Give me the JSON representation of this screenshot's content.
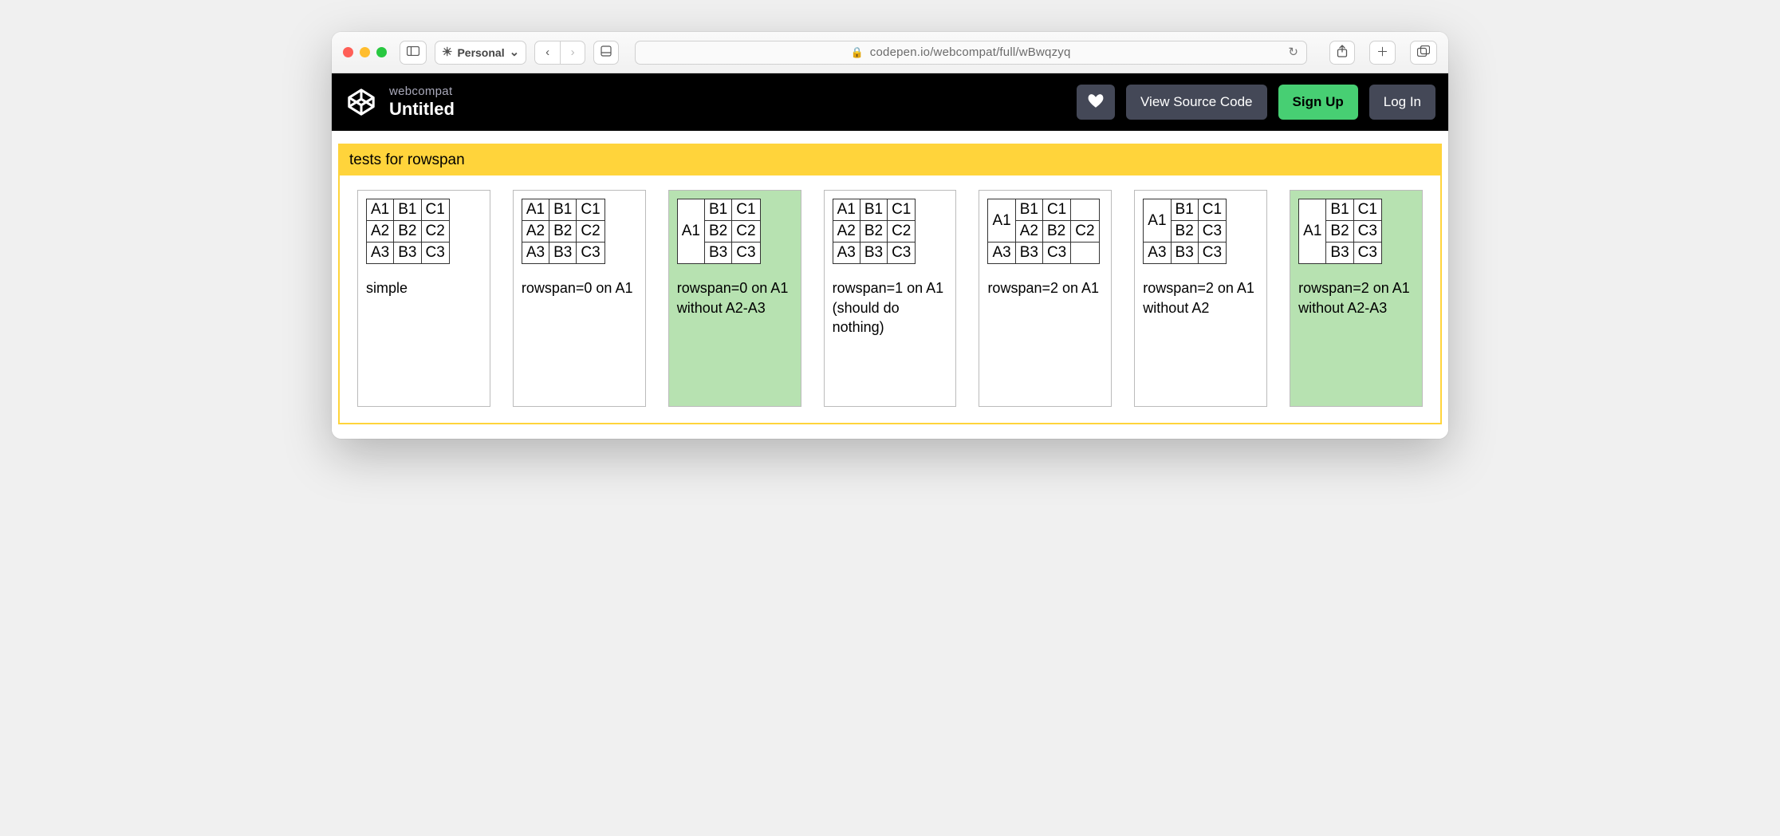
{
  "browser": {
    "profile_label": "Personal",
    "url_display": "codepen.io/webcompat/full/wBwqzyq"
  },
  "header": {
    "author": "webcompat",
    "title": "Untitled",
    "view_source_label": "View Source Code",
    "signup_label": "Sign Up",
    "login_label": "Log In"
  },
  "content": {
    "section_title": "tests for rowspan",
    "cards": [
      {
        "caption": "simple",
        "highlight": false,
        "table": {
          "rows": [
            [
              {
                "text": "A1"
              },
              {
                "text": "B1"
              },
              {
                "text": "C1"
              }
            ],
            [
              {
                "text": "A2"
              },
              {
                "text": "B2"
              },
              {
                "text": "C2"
              }
            ],
            [
              {
                "text": "A3"
              },
              {
                "text": "B3"
              },
              {
                "text": "C3"
              }
            ]
          ]
        }
      },
      {
        "caption": "rowspan=0 on A1",
        "highlight": false,
        "table": {
          "rows": [
            [
              {
                "text": "A1"
              },
              {
                "text": "B1"
              },
              {
                "text": "C1"
              }
            ],
            [
              {
                "text": "A2"
              },
              {
                "text": "B2"
              },
              {
                "text": "C2"
              }
            ],
            [
              {
                "text": "A3"
              },
              {
                "text": "B3"
              },
              {
                "text": "C3"
              }
            ]
          ]
        }
      },
      {
        "caption": "rowspan=0 on A1 without A2-A3",
        "highlight": true,
        "table": {
          "rows": [
            [
              {
                "text": "A1",
                "rowspan": 3
              },
              {
                "text": "B1"
              },
              {
                "text": "C1"
              }
            ],
            [
              {
                "text": "B2"
              },
              {
                "text": "C2"
              }
            ],
            [
              {
                "text": "B3"
              },
              {
                "text": "C3"
              }
            ]
          ]
        }
      },
      {
        "caption": "rowspan=1 on A1 (should do nothing)",
        "highlight": false,
        "table": {
          "rows": [
            [
              {
                "text": "A1"
              },
              {
                "text": "B1"
              },
              {
                "text": "C1"
              }
            ],
            [
              {
                "text": "A2"
              },
              {
                "text": "B2"
              },
              {
                "text": "C2"
              }
            ],
            [
              {
                "text": "A3"
              },
              {
                "text": "B3"
              },
              {
                "text": "C3"
              }
            ]
          ]
        }
      },
      {
        "caption": "rowspan=2 on A1",
        "highlight": false,
        "table": {
          "rows": [
            [
              {
                "text": "A1",
                "rowspan": 2
              },
              {
                "text": "B1"
              },
              {
                "text": "C1"
              }
            ],
            [
              {
                "text": "A2"
              },
              {
                "text": "B2"
              },
              {
                "text": "C2"
              }
            ],
            [
              {
                "text": "A3"
              },
              {
                "text": "B3"
              },
              {
                "text": "C3"
              }
            ]
          ]
        }
      },
      {
        "caption": "rowspan=2 on A1 without A2",
        "highlight": false,
        "table": {
          "rows": [
            [
              {
                "text": "A1",
                "rowspan": 2
              },
              {
                "text": "B1"
              },
              {
                "text": "C1"
              }
            ],
            [
              {
                "text": "B2"
              },
              {
                "text": "C3"
              }
            ],
            [
              {
                "text": "A3"
              },
              {
                "text": "B3"
              },
              {
                "text": "C3"
              }
            ]
          ]
        }
      },
      {
        "caption": "rowspan=2 on A1 without A2-A3",
        "highlight": true,
        "table": {
          "rows": [
            [
              {
                "text": "A1",
                "rowspan": 3
              },
              {
                "text": "B1"
              },
              {
                "text": "C1"
              }
            ],
            [
              {
                "text": "B2"
              },
              {
                "text": "C3"
              }
            ],
            [
              {
                "text": "B3"
              },
              {
                "text": "C3"
              }
            ]
          ]
        }
      }
    ]
  }
}
